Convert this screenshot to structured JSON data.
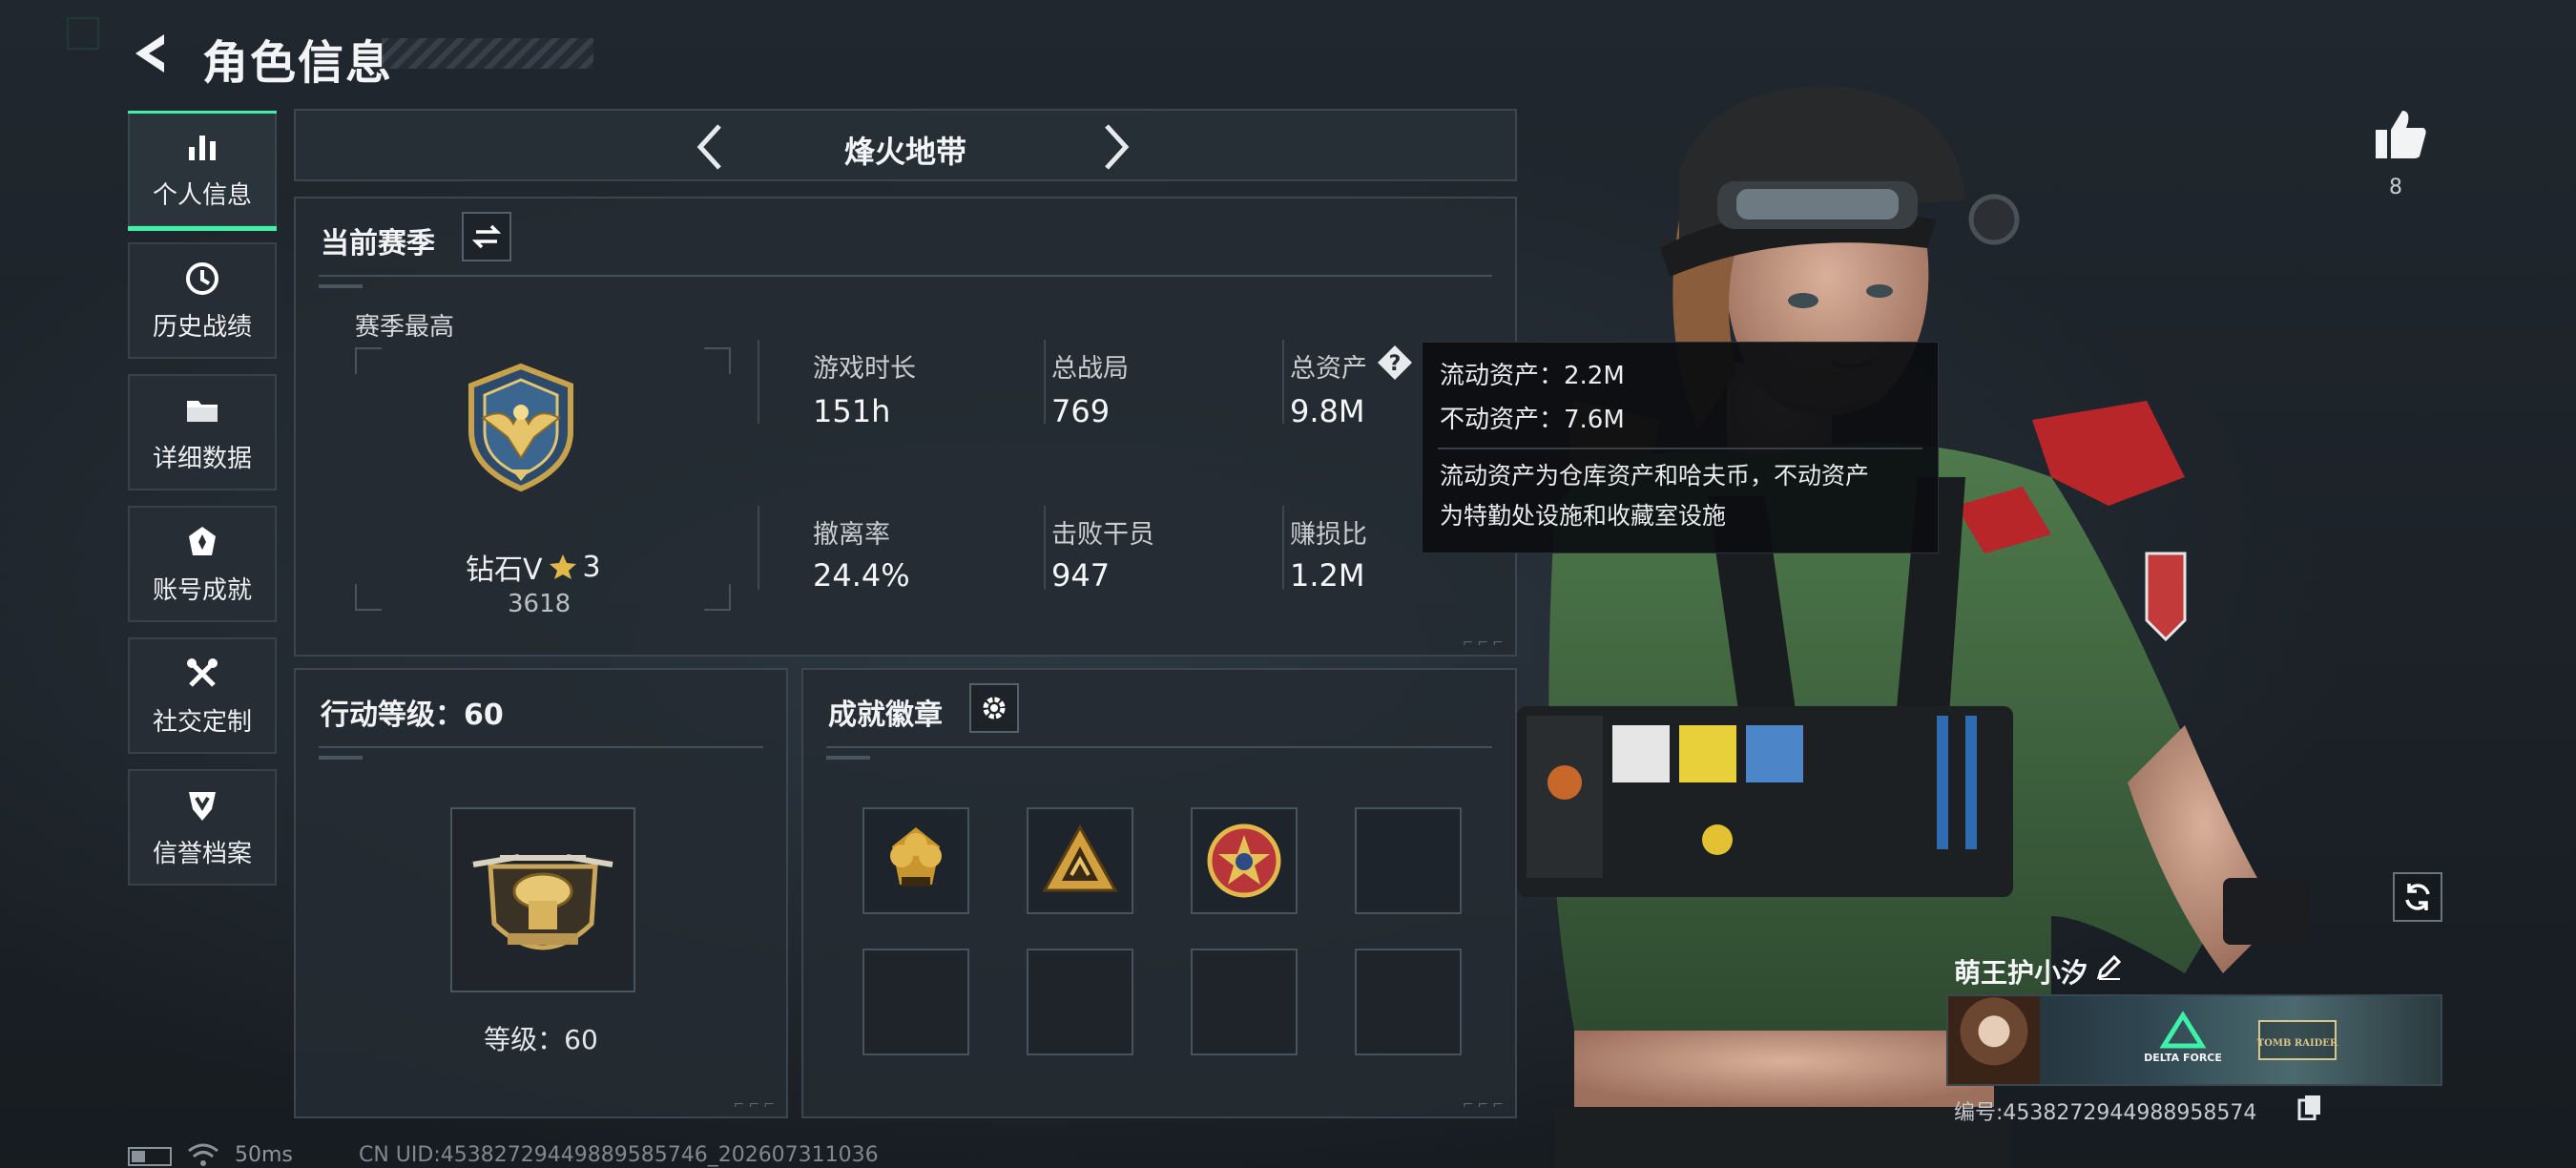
{
  "header": {
    "title": "角色信息"
  },
  "nav": {
    "items": [
      {
        "label": "个人信息",
        "icon": "bar-chart-icon",
        "active": true
      },
      {
        "label": "历史战绩",
        "icon": "history-clock-icon",
        "active": false
      },
      {
        "label": "详细数据",
        "icon": "folder-icon",
        "active": false
      },
      {
        "label": "账号成就",
        "icon": "achievement-icon",
        "active": false
      },
      {
        "label": "社交定制",
        "icon": "tools-icon",
        "active": false
      },
      {
        "label": "信誉档案",
        "icon": "credit-shield-icon",
        "active": false
      }
    ]
  },
  "mode": {
    "label": "烽火地带"
  },
  "season": {
    "title": "当前赛季",
    "best_label": "赛季最高",
    "rank_name": "钻石V",
    "rank_stars": "3",
    "rank_points": "3618",
    "stats": [
      {
        "label": "游戏时长",
        "value": "151h"
      },
      {
        "label": "总战局",
        "value": "769"
      },
      {
        "label": "总资产",
        "value": "9.8M"
      },
      {
        "label": "撤离率",
        "value": "24.4%"
      },
      {
        "label": "击败干员",
        "value": "947"
      },
      {
        "label": "赚损比",
        "value": "1.2M"
      }
    ]
  },
  "tooltip": {
    "line1": "流动资产：2.2M",
    "line2": "不动资产：7.6M",
    "desc1": "流动资产为仓库资产和哈夫币，不动资产",
    "desc2": "为特勤处设施和收藏室设施"
  },
  "action_level": {
    "title": "行动等级：60",
    "level_label": "等级：60"
  },
  "badges": {
    "title": "成就徽章",
    "slots": [
      "gold-tricorn-badge-icon",
      "gold-triangle-badge-icon",
      "star-emblem-badge-icon",
      "",
      "",
      "",
      "",
      ""
    ]
  },
  "player": {
    "like_count": "8",
    "name": "萌王护小汐",
    "id_text": "编号:4538272944988958574",
    "banner_logos": [
      "DELTA FORCE",
      "TOMB RAIDER"
    ]
  },
  "status": {
    "ping": "50ms",
    "uid": "CN UID:4538272944988958574​6_202607311036"
  },
  "colors": {
    "accent": "#3ef0a8",
    "panel": "#242b32"
  }
}
